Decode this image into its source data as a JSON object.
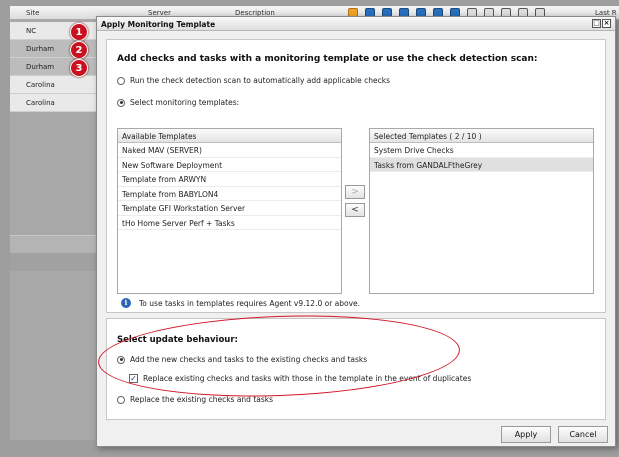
{
  "background_table": {
    "columns": {
      "site": "Site",
      "server": "Server",
      "description": "Description",
      "last": "Last R"
    },
    "header_icons": [
      "check-icon",
      "wrench-icon",
      "calendar-icon",
      "image-icon",
      "shield-icon",
      "shield-icon",
      "globe-icon",
      "clock-icon",
      "calendar-icon",
      "monitor-icon",
      "user-icon",
      "power-icon"
    ],
    "sites": [
      "NC",
      "Durham",
      "Durham",
      "Carolina",
      "Carolina"
    ]
  },
  "badges": [
    "1",
    "2",
    "3"
  ],
  "dialog": {
    "title": "Apply Monitoring Template",
    "heading": "Add checks and tasks with a monitoring template or use the check detection scan:",
    "option_scan": "Run the check detection scan to automatically add applicable checks",
    "option_templates": "Select monitoring templates:",
    "available": {
      "header": "Available Templates",
      "items": [
        "Naked MAV (SERVER)",
        "New Software Deployment",
        "Template from ARWYN",
        "Template from BABYLON4",
        "Template GFI Workstation Server",
        "tHo Home Server Perf + Tasks"
      ]
    },
    "selected": {
      "header": "Selected Templates ( 2 / 10 )",
      "items": [
        "System Drive Checks",
        "Tasks from GANDALFtheGrey"
      ]
    },
    "move_right": ">",
    "move_left": "<",
    "info": "To use tasks in templates requires Agent v9.12.0 or above.",
    "update_heading": "Select update behaviour:",
    "option_add": "Add the new checks and tasks to the existing checks and tasks",
    "option_replace_dupes": "Replace existing checks and tasks with those in the template in the event of duplicates",
    "option_replace_all": "Replace the existing checks and tasks",
    "apply": "Apply",
    "cancel": "Cancel",
    "window_buttons": [
      "□",
      "×"
    ]
  },
  "colors": {
    "badge": "#c8101f",
    "annotation": "#d01828",
    "info": "#2a66b8"
  }
}
